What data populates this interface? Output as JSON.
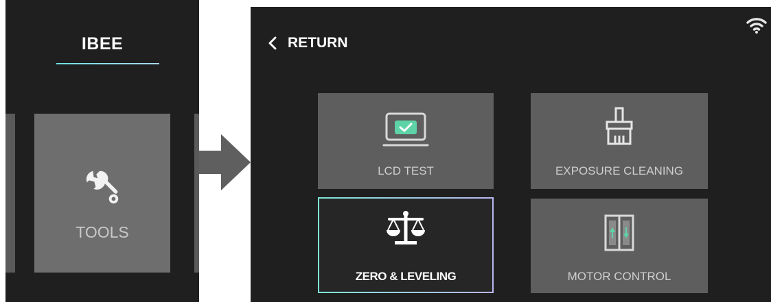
{
  "left_screen": {
    "brand": "IBEE",
    "tools_tile": {
      "label": "TOOLS",
      "icon": "wrench-icon"
    }
  },
  "right_screen": {
    "return_label": "RETURN",
    "status": {
      "wifi": "wifi-icon"
    },
    "tiles": [
      {
        "label": "LCD TEST",
        "icon": "monitor-check-icon",
        "selected": false
      },
      {
        "label": "EXPOSURE CLEANING",
        "icon": "brush-icon",
        "selected": false
      },
      {
        "label": "ZERO & LEVELING",
        "icon": "balance-scale-icon",
        "selected": true
      },
      {
        "label": "MOTOR CONTROL",
        "icon": "elevator-arrows-icon",
        "selected": false
      }
    ]
  },
  "colors": {
    "screen_bg": "#1f1f1f",
    "tile_bg": "#5e5e5e",
    "accent_teal": "#6fe3df",
    "accent_lavender": "#b9b8f2",
    "check_green": "#5fd3a8"
  }
}
